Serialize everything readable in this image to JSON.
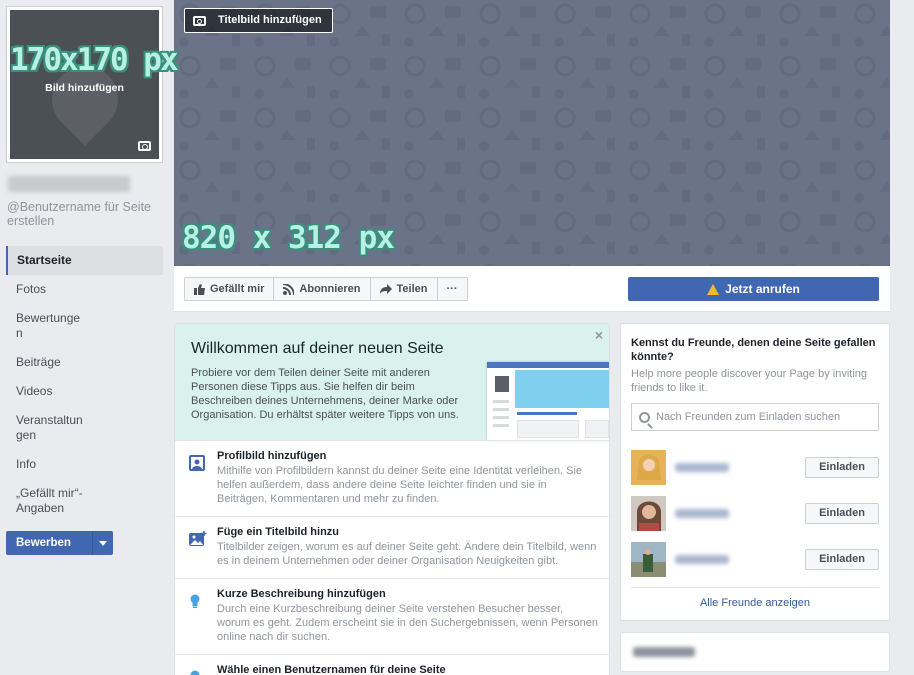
{
  "overlays": {
    "profile_dimensions": "170x170 px",
    "cover_dimensions": "820 x 312 px"
  },
  "profile": {
    "add_picture_label": "Bild hinzufügen",
    "camera_icon": "camera-icon"
  },
  "sidebar": {
    "username_link": "@Benutzername für Seite erstellen",
    "items": [
      {
        "label": "Startseite",
        "active": true
      },
      {
        "label": "Fotos"
      },
      {
        "label": "Bewertungen"
      },
      {
        "label": "Beiträge"
      },
      {
        "label": "Videos"
      },
      {
        "label": "Veranstaltungen"
      },
      {
        "label": "Info"
      },
      {
        "label": "„Gefällt mir“-Angaben"
      }
    ],
    "promote_button": "Bewerben"
  },
  "cover": {
    "add_cover_label": "Titelbild hinzufügen",
    "background_color": "#6b7388"
  },
  "action_bar": {
    "like_label": "Gefällt mir",
    "follow_label": "Abonnieren",
    "share_label": "Teilen",
    "more_label": "···",
    "call_label": "Jetzt anrufen",
    "call_color": "#4267b2"
  },
  "welcome": {
    "title": "Willkommen auf deiner neuen Seite",
    "text": "Probiere vor dem Teilen deiner Seite mit anderen Personen diese Tipps aus. Sie helfen dir beim Beschreiben deines Unternehmens, deiner Marke oder Organisation. Du erhältst später weitere Tipps von uns.",
    "close": "×",
    "tips": [
      {
        "title": "Profilbild hinzufügen",
        "desc": "Mithilfe von Profilbildern kannst du deiner Seite eine Identität verleihen. Sie helfen außerdem, dass andere deine Seite leichter finden und sie in Beiträgen, Kommentaren und mehr zu finden.",
        "icon": "profile-photo-icon"
      },
      {
        "title": "Füge ein Titelbild hinzu",
        "desc": "Titelbilder zeigen, worum es auf deiner Seite geht. Ändere dein Titelbild, wenn es in deinem Unternehmen oder deiner Organisation Neuigkeiten gibt.",
        "icon": "cover-photo-icon"
      },
      {
        "title": "Kurze Beschreibung hinzufügen",
        "desc": "Durch eine Kurzbeschreibung deiner Seite verstehen Besucher besser, worum es geht. Zudem erscheint sie in den Suchergebnissen, wenn Personen online nach dir suchen.",
        "icon": "lightbulb-icon"
      },
      {
        "title": "Wähle einen Benutzernamen für deine Seite",
        "desc": "",
        "icon": "lightbulb-icon"
      }
    ]
  },
  "invite": {
    "title": "Kennst du Freunde, denen deine Seite gefallen könnte?",
    "subtitle": "Help more people discover your Page by inviting friends to like it.",
    "search_placeholder": "Nach Freunden zum Einladen suchen",
    "friends": [
      {
        "invite_label": "Einladen"
      },
      {
        "invite_label": "Einladen"
      },
      {
        "invite_label": "Einladen"
      }
    ],
    "see_all": "Alle Freunde anzeigen"
  }
}
